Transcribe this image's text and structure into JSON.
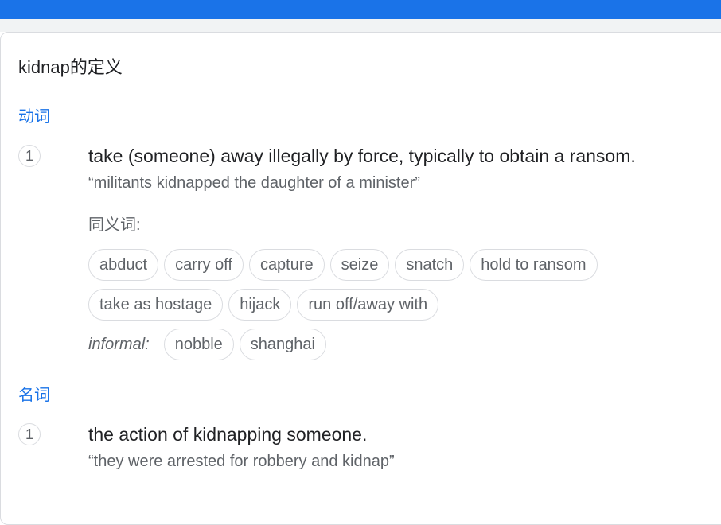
{
  "header": {
    "title": "kidnap的定义"
  },
  "verb": {
    "pos_label": "动词",
    "senses": [
      {
        "number": "1",
        "definition": "take (someone) away illegally by force, typically to obtain a ransom.",
        "example": "“militants kidnapped the daughter of a minister”"
      }
    ],
    "synonyms_label": "同义词:",
    "synonyms_row1": [
      "abduct",
      "carry off",
      "capture",
      "seize",
      "snatch",
      "hold to ransom"
    ],
    "synonyms_row2": [
      "take as hostage",
      "hijack",
      "run off/away with"
    ],
    "informal_label": "informal:",
    "informal_synonyms": [
      "nobble",
      "shanghai"
    ]
  },
  "noun": {
    "pos_label": "名词",
    "senses": [
      {
        "number": "1",
        "definition": "the action of kidnapping someone.",
        "example": "“they were arrested for robbery and kidnap”"
      }
    ]
  },
  "colors": {
    "accent": "#1a73e8",
    "text_primary": "#202124",
    "text_secondary": "#5f6368",
    "border": "#dadce0"
  }
}
